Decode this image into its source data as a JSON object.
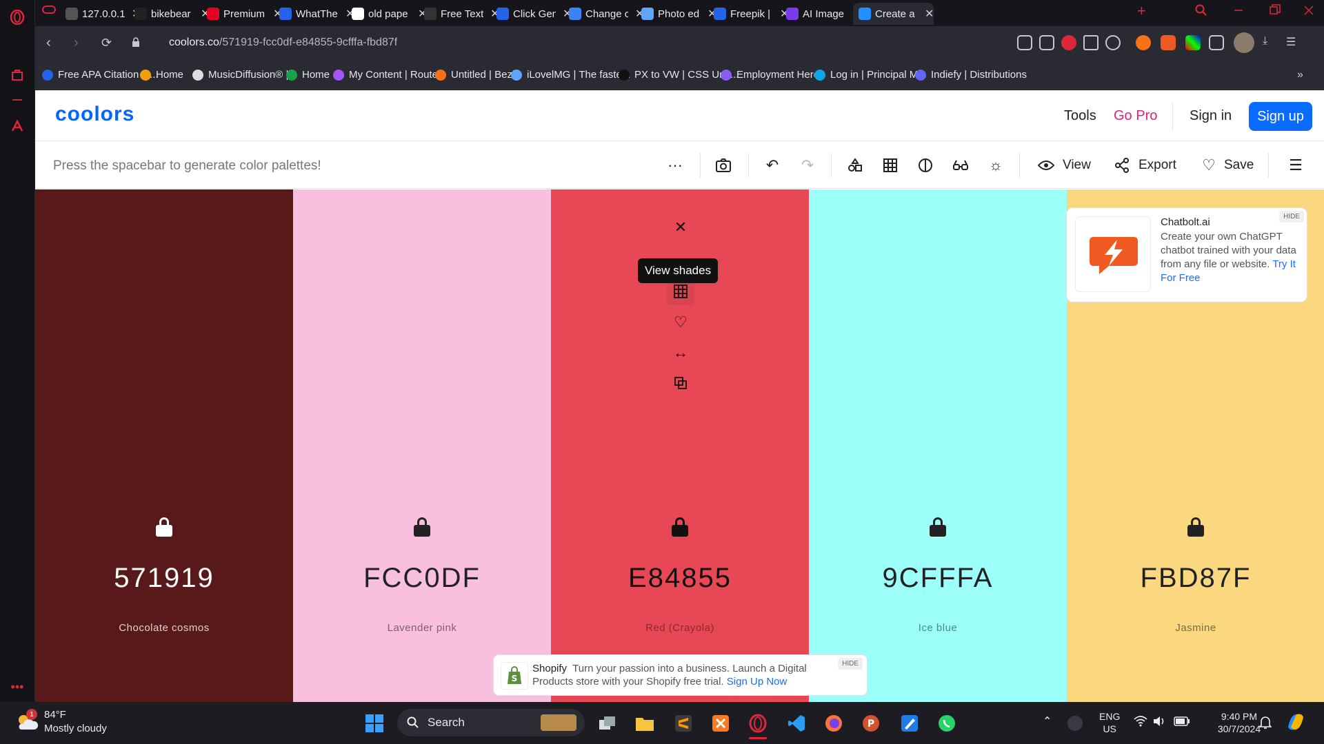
{
  "browser": {
    "tabs": [
      {
        "title": "127.0.0.1",
        "color": "#555"
      },
      {
        "title": "bikebear",
        "color": "#222"
      },
      {
        "title": "Premium",
        "color": "#e60023"
      },
      {
        "title": "WhatThe",
        "color": "#2563eb"
      },
      {
        "title": "old pape",
        "color": "#fff"
      },
      {
        "title": "Free Text",
        "color": "#333"
      },
      {
        "title": "Click Gen",
        "color": "#2563eb"
      },
      {
        "title": "Change c",
        "color": "#3b82f6"
      },
      {
        "title": "Photo ed",
        "color": "#60a5fa"
      },
      {
        "title": "Freepik |",
        "color": "#2563eb"
      },
      {
        "title": "AI Image",
        "color": "#7c3aed"
      },
      {
        "title": "Create a",
        "color": "#1e90ff"
      }
    ],
    "url_host": "coolors.co",
    "url_path": "/571919-fcc0df-e84855-9cfffa-fbd87f",
    "bookmarks": [
      "Free APA Citation G...",
      "Home",
      "MusicDiffusion® |...",
      "Home",
      "My Content | Route...",
      "Untitled | Bezi",
      "iLovelMG | The faste...",
      "PX to VW | CSS Unit...",
      "Employment Hero",
      "Log in | Principal M...",
      "Indiefy | Distributions"
    ]
  },
  "header": {
    "logo": "coolors",
    "tools": "Tools",
    "go_pro": "Go Pro",
    "sign_in": "Sign in",
    "sign_up": "Sign up"
  },
  "toolbar": {
    "hint": "Press the spacebar to generate color palettes!",
    "view": "View",
    "export": "Export",
    "save": "Save"
  },
  "palette": [
    {
      "hex": "571919",
      "name": "Chocolate cosmos",
      "bg": "#571919",
      "fg": "#ffffff",
      "sub": "#e8cccc"
    },
    {
      "hex": "FCC0DF",
      "name": "Lavender pink",
      "bg": "#F9BFDF",
      "fg": "#222222",
      "sub": "#7a6070"
    },
    {
      "hex": "E84855",
      "name": "Red (Crayola)",
      "bg": "#E84855",
      "fg": "#111111",
      "sub": "#8a2a32"
    },
    {
      "hex": "9CFFFA",
      "name": "Ice blue",
      "bg": "#9CFFFA",
      "fg": "#222222",
      "sub": "#4a8a88"
    },
    {
      "hex": "FBD87F",
      "name": "Jasmine",
      "bg": "#FBD87F",
      "fg": "#222222",
      "sub": "#7a6a44"
    }
  ],
  "tooltip": "View shades",
  "ad_chatbolt": {
    "title": "Chatbolt.ai",
    "desc": "Create your own ChatGPT chatbot trained with your data from any file or website.",
    "cta": "Try It For Free",
    "hide": "HIDE"
  },
  "ad_shopify": {
    "brand": "Shopify",
    "desc": "Turn your passion into a business. Launch a Digital Products store with your Shopify free trial.",
    "cta": "Sign Up Now",
    "hide": "HIDE"
  },
  "taskbar": {
    "weather_temp": "84°F",
    "weather_desc": "Mostly cloudy",
    "weather_badge": "1",
    "search": "Search",
    "lang1": "ENG",
    "lang2": "US",
    "time": "9:40 PM",
    "date": "30/7/2024"
  }
}
